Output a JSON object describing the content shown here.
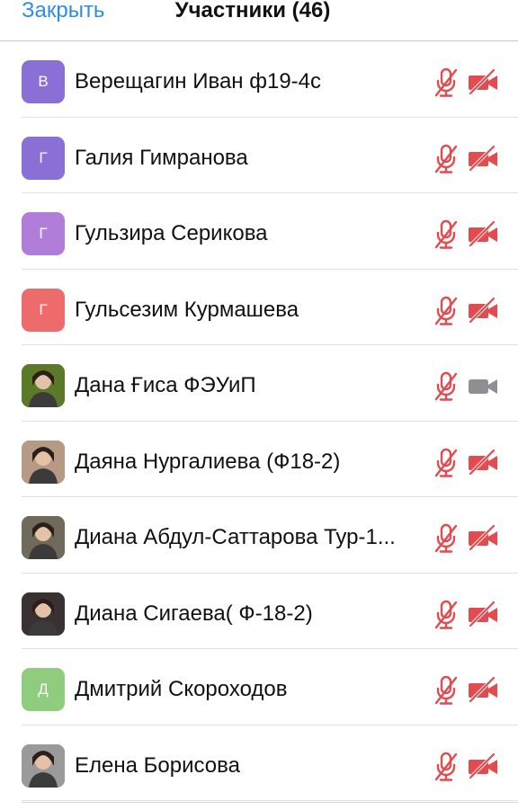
{
  "header": {
    "close_label": "Закрыть",
    "title": "Участники (46)"
  },
  "colors": {
    "link": "#2d8cf0",
    "muted_red": "#e24c50",
    "camera_on_gray": "#8e8e93"
  },
  "participants": [
    {
      "name": "Верещагин Иван ф19-4с",
      "avatar_type": "initial",
      "initial": "В",
      "avatar_color": "#8a6fd6",
      "mic_muted": true,
      "video_off": true
    },
    {
      "name": "Галия Гимранова",
      "avatar_type": "initial",
      "initial": "Г",
      "avatar_color": "#8a6fd6",
      "mic_muted": true,
      "video_off": true
    },
    {
      "name": "Гульзира Серикова",
      "avatar_type": "initial",
      "initial": "Г",
      "avatar_color": "#b07ed8",
      "mic_muted": true,
      "video_off": true
    },
    {
      "name": "Гульсезим Курмашева",
      "avatar_type": "initial",
      "initial": "Г",
      "avatar_color": "#ee6b6b",
      "mic_muted": true,
      "video_off": true
    },
    {
      "name": "Дана Ғиса ФЭУиП",
      "avatar_type": "photo",
      "avatar_color": "#5a7a2a",
      "mic_muted": true,
      "video_off": false
    },
    {
      "name": "Даяна Нургалиева (Ф18-2)",
      "avatar_type": "photo",
      "avatar_color": "#b79a86",
      "mic_muted": true,
      "video_off": true
    },
    {
      "name": "Диана Абдул-Саттарова Тур-1...",
      "avatar_type": "photo",
      "avatar_color": "#6f6a5a",
      "mic_muted": true,
      "video_off": true
    },
    {
      "name": "Диана Сигаева( Ф-18-2)",
      "avatar_type": "photo",
      "avatar_color": "#3a3230",
      "mic_muted": true,
      "video_off": true
    },
    {
      "name": "Дмитрий Скороходов",
      "avatar_type": "initial",
      "initial": "Д",
      "avatar_color": "#8fcc7e",
      "mic_muted": true,
      "video_off": true
    },
    {
      "name": "Елена Борисова",
      "avatar_type": "photo",
      "avatar_color": "#9a9a9a",
      "mic_muted": true,
      "video_off": true
    }
  ]
}
